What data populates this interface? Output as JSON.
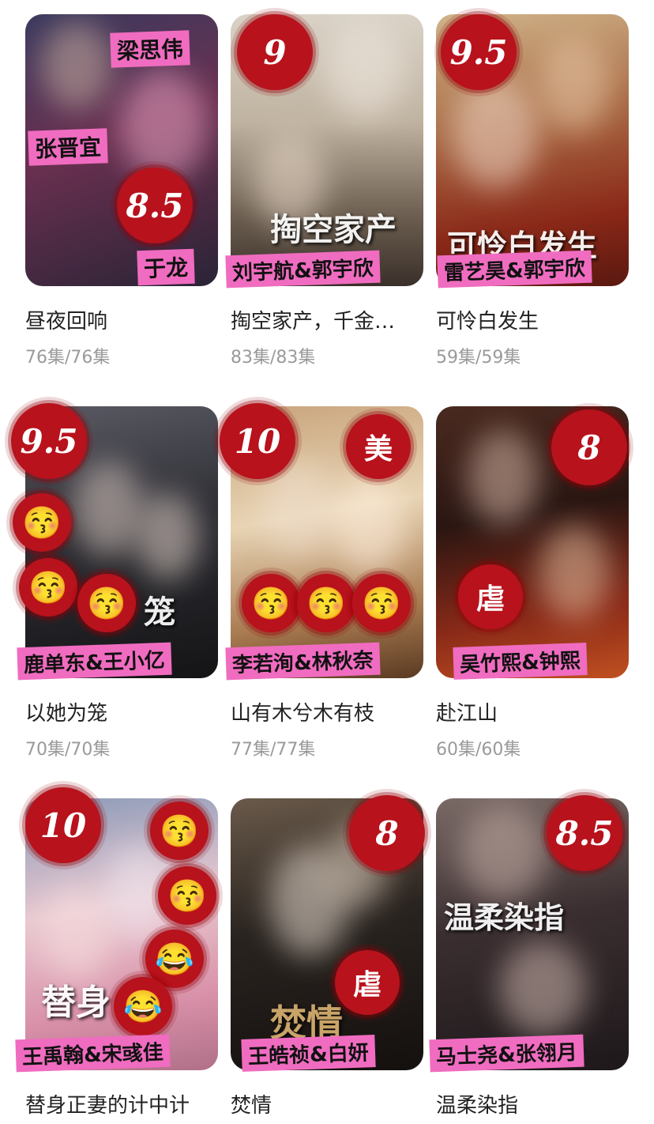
{
  "dramas": [
    {
      "title": "昼夜回响",
      "episodes": "76集/76集",
      "score": "8.5",
      "cast": [
        "梁思伟",
        "张晋宜",
        "于龙"
      ],
      "colors": [
        "#2a2e4a",
        "#7a3a5a",
        "#c05070"
      ]
    },
    {
      "title": "掏空家产，千金…",
      "episodes": "83集/83集",
      "score": "9",
      "cast_tag": "刘宇航&郭宇欣",
      "poster_text": "掏空家产",
      "colors": [
        "#d8d0c4",
        "#8a7a68",
        "#4a4038"
      ]
    },
    {
      "title": "可怜白发生",
      "episodes": "59集/59集",
      "score": "9.5",
      "cast_tag": "雷艺昊&郭宇欣",
      "poster_text": "可怜白发生",
      "colors": [
        "#c8a87a",
        "#8a2a1a",
        "#5a1a10"
      ]
    },
    {
      "title": "以她为笼",
      "episodes": "70集/70集",
      "score": "9.5",
      "cast_tag": "鹿单东&王小亿",
      "emoji": [
        "😚",
        "😚",
        "😚"
      ],
      "poster_text": "笼",
      "colors": [
        "#3a3a40",
        "#1a1a1e",
        "#6a6a70"
      ]
    },
    {
      "title": "山有木兮木有枝",
      "episodes": "77集/77集",
      "score": "10",
      "word_badge": "美",
      "cast_tag": "李若洵&林秋奈",
      "emoji": [
        "😚",
        "😚",
        "😚"
      ],
      "colors": [
        "#b89068",
        "#e8d0b0",
        "#6a4a30"
      ]
    },
    {
      "title": "赴江山",
      "episodes": "60集/60集",
      "score": "8",
      "word_badge": "虐",
      "cast_tag": "吴竹熙&钟熙",
      "colors": [
        "#3a1a14",
        "#8a2a1a",
        "#c84a20"
      ]
    },
    {
      "title": "替身正妻的计中计",
      "episodes": "",
      "score": "10",
      "cast_tag": "王禹翰&宋彧佳",
      "emoji": [
        "😚",
        "😚",
        "😂",
        "😂"
      ],
      "poster_text": "替身",
      "colors": [
        "#f0d0d8",
        "#d890a8",
        "#7a8aa8"
      ]
    },
    {
      "title": "焚情",
      "episodes": "",
      "score": "8",
      "word_badge": "虐",
      "cast_tag": "王皓祯&白妍",
      "poster_text": "焚情",
      "colors": [
        "#4a3a30",
        "#1e1a18",
        "#8a7060"
      ]
    },
    {
      "title": "温柔染指",
      "episodes": "",
      "score": "8.5",
      "cast_tag": "马士尧&张翎月",
      "poster_text": "温柔染指",
      "colors": [
        "#6a5a58",
        "#2a2024",
        "#a08880"
      ]
    }
  ]
}
